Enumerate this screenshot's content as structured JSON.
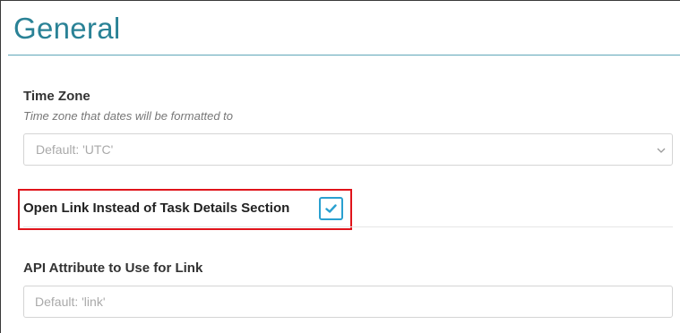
{
  "section": {
    "title": "General"
  },
  "timezone": {
    "label": "Time Zone",
    "description": "Time zone that dates will be formatted to",
    "selected_value": "Default: 'UTC'",
    "icon": "chevron-down-icon"
  },
  "open_link": {
    "label": "Open Link Instead of Task Details Section",
    "checked": true,
    "icon": "checkmark-icon",
    "accent_color": "#2aa0d0",
    "highlight_color": "#e0141b"
  },
  "api_attribute": {
    "label": "API Attribute to Use for Link",
    "value": "",
    "placeholder": "Default: 'link'"
  },
  "colors": {
    "title": "#2a8296",
    "label": "#333333",
    "placeholder": "#a9a9a9"
  }
}
